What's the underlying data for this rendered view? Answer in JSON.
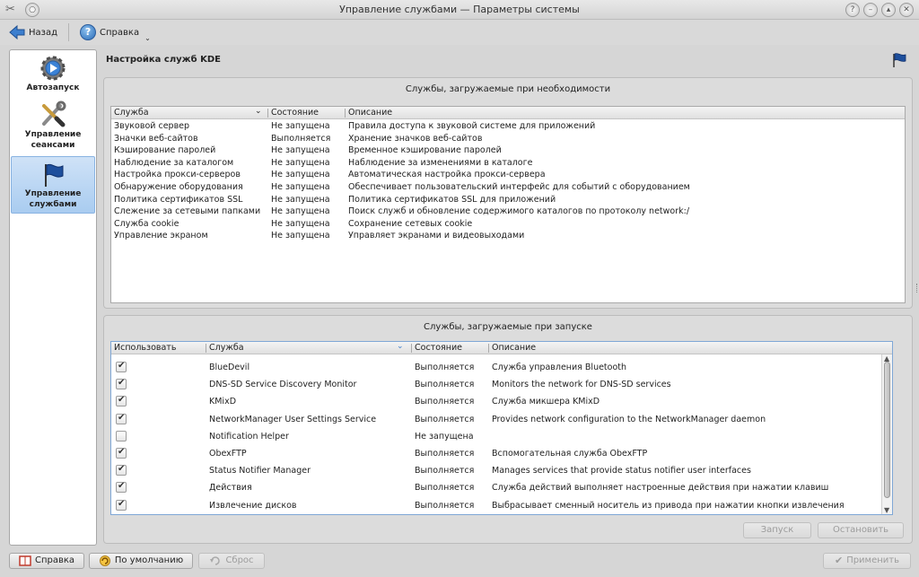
{
  "window": {
    "title": "Управление службами — Параметры системы",
    "buttons": [
      "?",
      "–",
      "▴",
      "✕"
    ]
  },
  "toolbar": {
    "back_label": "Назад",
    "help_label": "Справка"
  },
  "sidebar": {
    "items": [
      {
        "label_line1": "Автозапуск",
        "label_line2": ""
      },
      {
        "label_line1": "Управление",
        "label_line2": "сеансами"
      },
      {
        "label_line1": "Управление",
        "label_line2": "службами"
      }
    ],
    "selected": "Управление службами"
  },
  "page": {
    "title": "Настройка служб KDE"
  },
  "on_demand": {
    "title": "Службы, загружаемые при необходимости",
    "columns": [
      "Служба",
      "Состояние",
      "Описание"
    ],
    "rows": [
      {
        "service": "Звуковой сервер",
        "state": "Не запущена",
        "desc": "Правила доступа к звуковой системе для приложений"
      },
      {
        "service": "Значки веб-сайтов",
        "state": "Выполняется",
        "desc": "Хранение значков веб-сайтов"
      },
      {
        "service": "Кэширование паролей",
        "state": "Не запущена",
        "desc": "Временное кэширование паролей"
      },
      {
        "service": "Наблюдение за каталогом",
        "state": "Не запущена",
        "desc": "Наблюдение за изменениями в каталоге"
      },
      {
        "service": "Настройка прокси-серверов",
        "state": "Не запущена",
        "desc": "Автоматическая настройка прокси-сервера"
      },
      {
        "service": "Обнаружение оборудования",
        "state": "Не запущена",
        "desc": "Обеспечивает пользовательский интерфейс для событий с оборудованием"
      },
      {
        "service": "Политика сертификатов SSL",
        "state": "Не запущена",
        "desc": "Политика сертификатов SSL для приложений"
      },
      {
        "service": "Слежение за сетевыми папками",
        "state": "Не запущена",
        "desc": "Поиск служб и обновление содержимого каталогов по протоколу network:/"
      },
      {
        "service": "Служба cookie",
        "state": "Не запущена",
        "desc": "Сохранение сетевых cookie"
      },
      {
        "service": "Управление экраном",
        "state": "Не запущена",
        "desc": "Управляет экранами и видеовыходами"
      }
    ]
  },
  "startup": {
    "title": "Службы, загружаемые при запуске",
    "columns": [
      "Использовать",
      "Служба",
      "Состояние",
      "Описание"
    ],
    "rows": [
      {
        "checked": true,
        "service": "BlueDevil",
        "state": "Выполняется",
        "desc": "Служба управления Bluetooth"
      },
      {
        "checked": true,
        "service": "DNS-SD Service Discovery Monitor",
        "state": "Выполняется",
        "desc": "Monitors the network for DNS-SD services"
      },
      {
        "checked": true,
        "service": "KMixD",
        "state": "Выполняется",
        "desc": "Служба микшера KMixD"
      },
      {
        "checked": true,
        "service": "NetworkManager User Settings Service",
        "state": "Выполняется",
        "desc": "Provides network configuration to the NetworkManager daemon"
      },
      {
        "checked": false,
        "service": "Notification Helper",
        "state": "Не запущена",
        "desc": ""
      },
      {
        "checked": true,
        "service": "ObexFTP",
        "state": "Выполняется",
        "desc": "Вспомогательная служба ObexFTP"
      },
      {
        "checked": true,
        "service": "Status Notifier Manager",
        "state": "Выполняется",
        "desc": "Manages services that provide status notifier user interfaces"
      },
      {
        "checked": true,
        "service": "Действия",
        "state": "Выполняется",
        "desc": "Служба действий выполняет настроенные действия при нажатии клавиш"
      },
      {
        "checked": true,
        "service": "Извлечение дисков",
        "state": "Выполняется",
        "desc": "Выбрасывает сменный носитель из привода при нажатии кнопки извлечения"
      }
    ],
    "start_label": "Запуск",
    "stop_label": "Остановить"
  },
  "footer": {
    "help_label": "Справка",
    "defaults_label": "По умолчанию",
    "reset_label": "Сброс",
    "apply_label": "Применить"
  },
  "colors": {
    "selection": "#a9ccf0",
    "accent": "#2a6cb8"
  }
}
